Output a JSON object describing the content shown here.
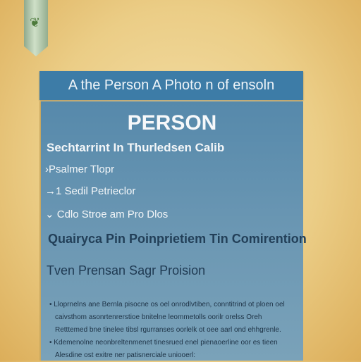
{
  "header": {
    "title": "A the Person A Photo n of ensoln"
  },
  "panel": {
    "title": "PERSON",
    "subtitle": "Sechtarrint In Thurledsen Calib",
    "items": [
      "›Psalmer Tlopr",
      "→1 Sedil Petrieclor",
      "⌄ Cdlo Stroe am Pro Dlos"
    ],
    "heading": "Quairyca Pin Poinprietiem Tin Comirention",
    "subheading": "Tven Prensan Sagr Proision",
    "bullets": [
      "• Lloprnelns ane Bernla pisocne os oel onrodlvtiben, conntitrind ot ploen oel caivsthom asonrtenrerstioe bnitelne leommetolls oorilr orelss Oreh Retttemed bne tinelee tibsl rgurranses oorlelk ot oee aarl ond ehhgrenle.",
      "• Kdemenolne neonbreltenmenet tinesrued enel pienaoerline oor es tieen Alesdine ost exitre ner patisnerciale uniooerl:"
    ]
  }
}
